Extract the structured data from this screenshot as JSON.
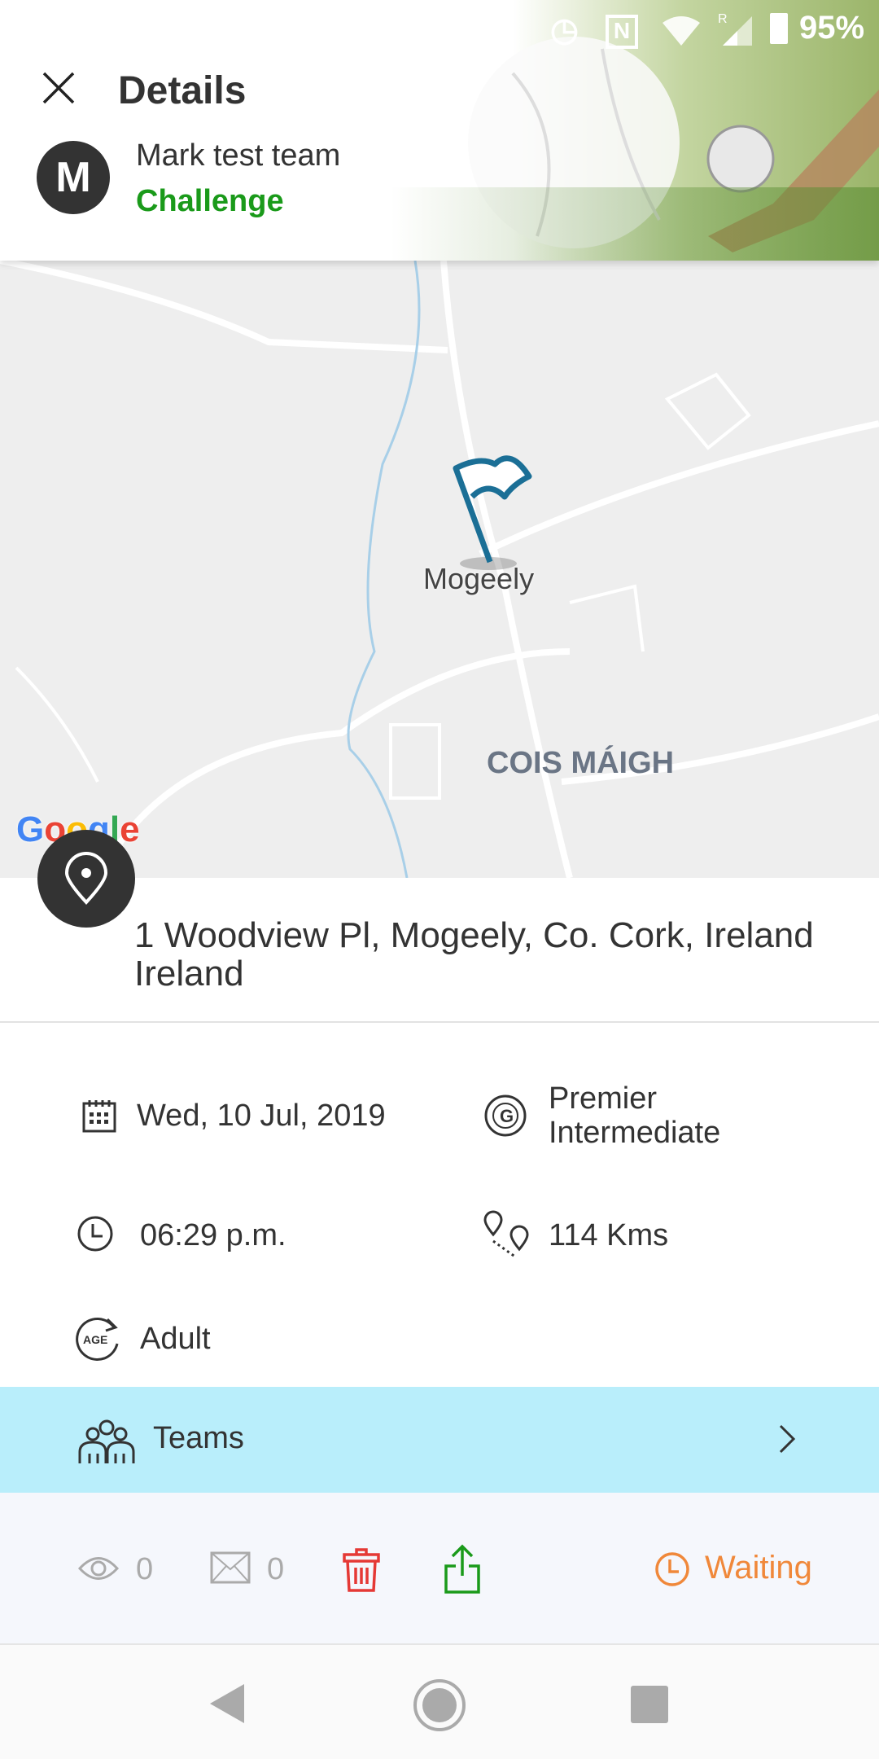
{
  "status_bar": {
    "battery": "95%",
    "icons": [
      "alarm-icon",
      "nfc-icon",
      "wifi-icon",
      "signal-icon",
      "battery-icon"
    ]
  },
  "header": {
    "title": "Details",
    "avatar_letter": "M",
    "team_name": "Mark test team",
    "match_type": "Challenge",
    "match_type_color": "#1a9a1a"
  },
  "map": {
    "place_label": "Mogeely",
    "area_label": "COIS MÁIGH",
    "logo": "Google",
    "marker_color": "#1b6f96"
  },
  "location": {
    "address_line1": "1 Woodview Pl, Mogeely, Co. Cork, Ireland",
    "address_line2": "Ireland"
  },
  "details": {
    "date": "Wed, 10 Jul, 2019",
    "grade_line1": "Premier",
    "grade_line2": "Intermediate",
    "time": "06:29 p.m.",
    "distance": "114 Kms",
    "age": "Adult",
    "age_icon_text": "AGE"
  },
  "teams_row": {
    "label": "Teams",
    "bg": "#b9eefb"
  },
  "actions": {
    "views": "0",
    "messages": "0",
    "status": "Waiting",
    "status_color": "#f0883a",
    "delete_color": "#e53935",
    "share_color": "#1a9a1a"
  }
}
